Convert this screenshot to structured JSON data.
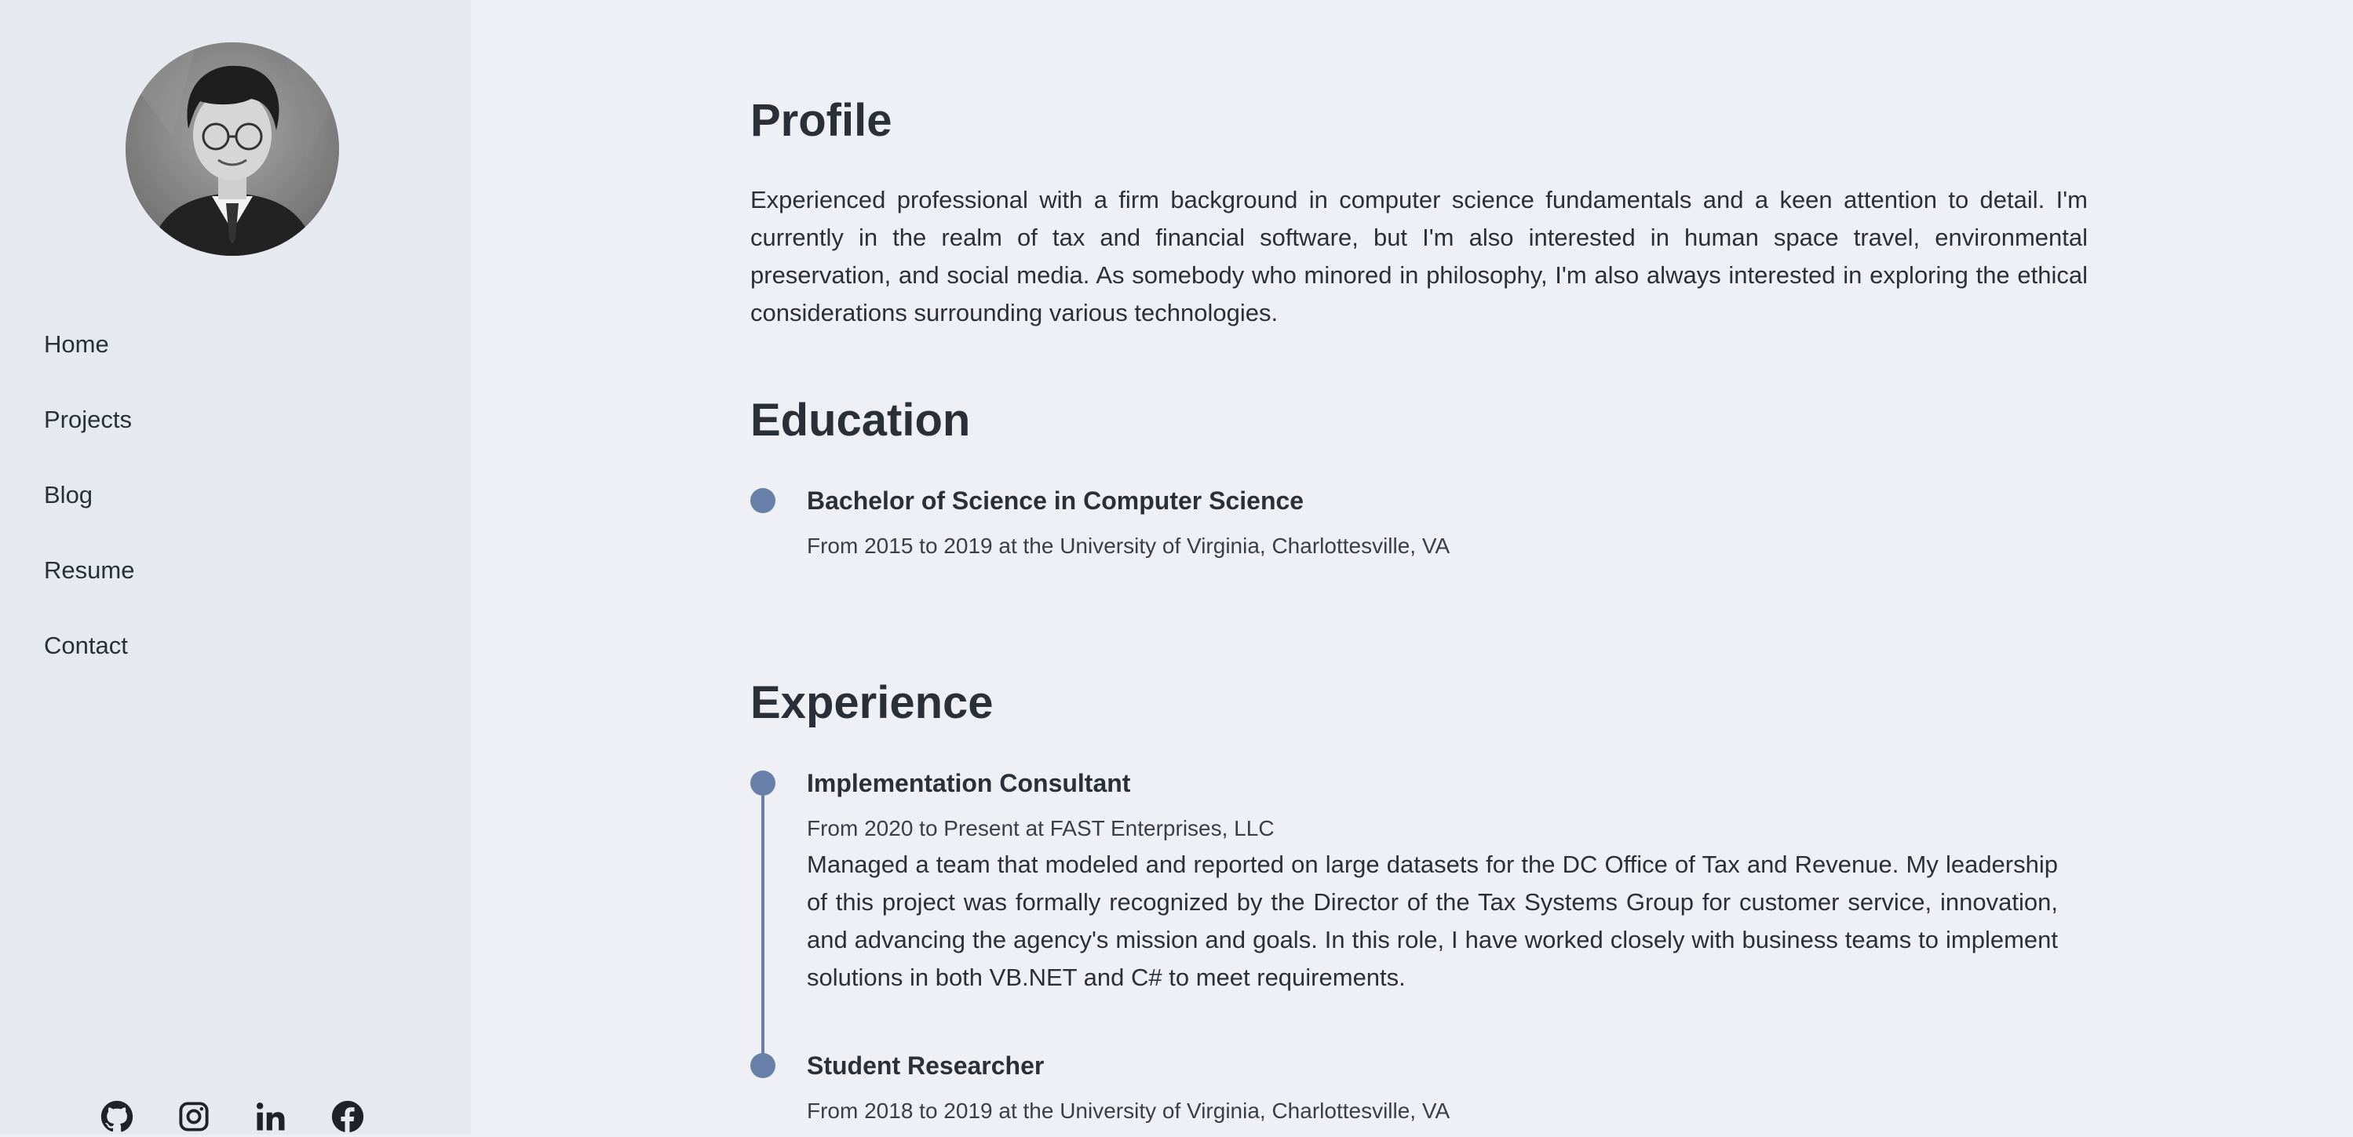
{
  "sidebar": {
    "nav": [
      "Home",
      "Projects",
      "Blog",
      "Resume",
      "Contact"
    ],
    "socials": [
      "github-icon",
      "instagram-icon",
      "linkedin-icon",
      "facebook-icon"
    ]
  },
  "profile": {
    "heading": "Profile",
    "text": "Experienced professional with a firm background in computer science fundamentals and a keen attention to detail. I'm currently in the realm of tax and financial software, but I'm also interested in human space travel, environmental preservation, and social media. As somebody who minored in philosophy, I'm also always interested in exploring the ethical considerations surrounding various technologies."
  },
  "education": {
    "heading": "Education",
    "items": [
      {
        "title": "Bachelor of Science in Computer Science",
        "subtitle": "From 2015 to 2019 at the University of Virginia, Charlottesville, VA"
      }
    ]
  },
  "experience": {
    "heading": "Experience",
    "items": [
      {
        "title": "Implementation Consultant",
        "subtitle": "From 2020 to Present at FAST Enterprises, LLC",
        "description": "Managed a team that modeled and reported on large datasets for the DC Office of Tax and Revenue. My leadership of this project was formally recognized by the Director of the Tax Systems Group for customer service, innovation, and advancing the agency's mission and goals. In this role, I have worked closely with business teams to implement solutions in both VB.NET and C# to meet requirements."
      },
      {
        "title": "Student Researcher",
        "subtitle": "From 2018 to 2019 at the University of Virginia, Charlottesville, VA"
      }
    ]
  },
  "colors": {
    "accent": "#6880aa",
    "sidebar_bg": "#e6e9f0",
    "page_bg": "#eef0f5",
    "text": "#2b2f38"
  }
}
